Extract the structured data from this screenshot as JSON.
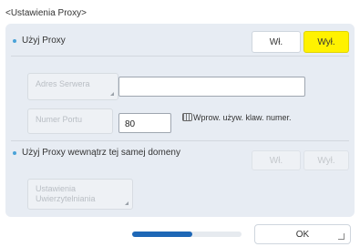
{
  "window": {
    "title": "<Ustawienia Proxy>"
  },
  "use_proxy": {
    "label": "Użyj Proxy",
    "on_label": "Wł.",
    "off_label": "Wył.",
    "selected": "off"
  },
  "server_address": {
    "button_label": "Adres Serwera",
    "value": ""
  },
  "port_number": {
    "button_label": "Numer Portu",
    "value": "80",
    "hint": "Wprow. używ. klaw. numer."
  },
  "same_domain": {
    "label": "Użyj Proxy wewnątrz tej samej domeny",
    "on_label": "Wł.",
    "off_label": "Wył."
  },
  "auth_settings": {
    "line1": "Ustawienia",
    "line2": "Uwierzytelniania"
  },
  "footer": {
    "ok_label": "OK",
    "progress": 0.55
  },
  "colors": {
    "accent": "#fff200",
    "bullet": "#4aa3d8",
    "progress": "#1e67b6"
  },
  "icons": {
    "keypad": "keypad-icon"
  }
}
